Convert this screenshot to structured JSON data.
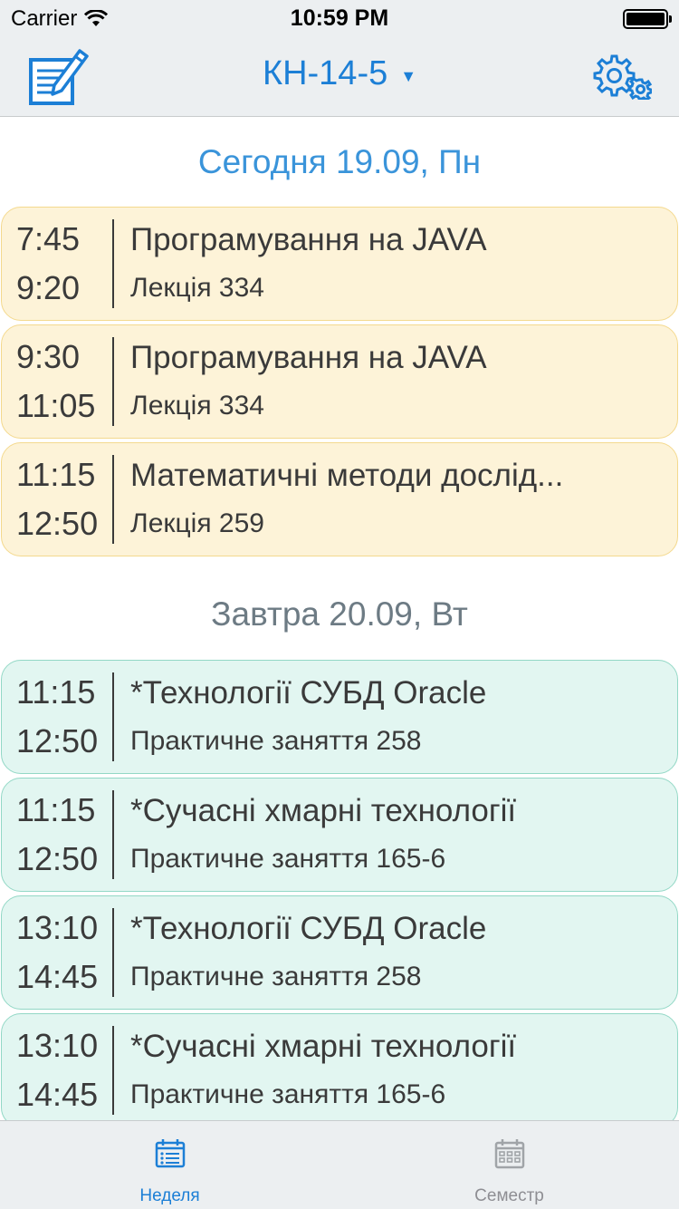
{
  "status_bar": {
    "carrier": "Carrier",
    "time": "10:59 PM"
  },
  "nav": {
    "title": "КН-14-5",
    "caret": "▼"
  },
  "days": [
    {
      "header": "Сегодня 19.09, Пн",
      "lessons": [
        {
          "start": "7:45",
          "end": "9:20",
          "subject": "Програмування на JAVA",
          "room": "Лекція 334"
        },
        {
          "start": "9:30",
          "end": "11:05",
          "subject": "Програмування на JAVA",
          "room": "Лекція 334"
        },
        {
          "start": "11:15",
          "end": "12:50",
          "subject": "Математичні методи дослід...",
          "room": "Лекція 259"
        }
      ]
    },
    {
      "header": "Завтра 20.09, Вт",
      "lessons": [
        {
          "start": "11:15",
          "end": "12:50",
          "subject": "*Технології СУБД Oracle",
          "room": "Практичне заняття 258"
        },
        {
          "start": "11:15",
          "end": "12:50",
          "subject": "*Сучасні хмарні технології",
          "room": "Практичне заняття 165-6"
        },
        {
          "start": "13:10",
          "end": "14:45",
          "subject": "*Технології СУБД Oracle",
          "room": "Практичне заняття 258"
        },
        {
          "start": "13:10",
          "end": "14:45",
          "subject": "*Сучасні хмарні технології",
          "room": "Практичне заняття 165-6"
        }
      ]
    }
  ],
  "tabs": [
    {
      "label": "Неделя",
      "icon": "week-list-icon",
      "active": true
    },
    {
      "label": "Семестр",
      "icon": "calendar-grid-icon",
      "active": false
    }
  ],
  "colors": {
    "accent": "#1c7fd6",
    "today_card": "#fdf3d8",
    "tomorrow_card": "#e2f6f1",
    "today_header": "#3a94da",
    "tomorrow_header": "#6d7b84"
  }
}
